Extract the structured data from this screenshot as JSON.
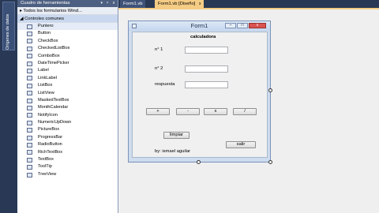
{
  "side_tabs": [
    {
      "label": "Orígenes de datos"
    },
    {
      "label": "Cuadro de herramientas"
    }
  ],
  "toolbox": {
    "title": "Cuadro de herramientas",
    "header_buttons": [
      "▾",
      "ᵖ",
      "x"
    ],
    "group_all": "▸ Todos los formularios Wind...",
    "group_common": "◢ Controles comunes",
    "items": [
      {
        "label": "Puntero",
        "icon": "pointer-icon"
      },
      {
        "label": "Button",
        "icon": "button-icon"
      },
      {
        "label": "CheckBox",
        "icon": "checkbox-icon"
      },
      {
        "label": "CheckedListBox",
        "icon": "checkedlistbox-icon"
      },
      {
        "label": "ComboBox",
        "icon": "combobox-icon"
      },
      {
        "label": "DateTimePicker",
        "icon": "datetimepicker-icon"
      },
      {
        "label": "Label",
        "icon": "label-icon"
      },
      {
        "label": "LinkLabel",
        "icon": "linklabel-icon"
      },
      {
        "label": "ListBox",
        "icon": "listbox-icon"
      },
      {
        "label": "ListView",
        "icon": "listview-icon"
      },
      {
        "label": "MaskedTextBox",
        "icon": "maskedtextbox-icon"
      },
      {
        "label": "MonthCalendar",
        "icon": "monthcalendar-icon"
      },
      {
        "label": "NotifyIcon",
        "icon": "notifyicon-icon"
      },
      {
        "label": "NumericUpDown",
        "icon": "numericupdown-icon"
      },
      {
        "label": "PictureBox",
        "icon": "picturebox-icon"
      },
      {
        "label": "ProgressBar",
        "icon": "progressbar-icon"
      },
      {
        "label": "RadioButton",
        "icon": "radiobutton-icon"
      },
      {
        "label": "RichTextBox",
        "icon": "richtextbox-icon"
      },
      {
        "label": "TextBox",
        "icon": "textbox-icon"
      },
      {
        "label": "ToolTip",
        "icon": "tooltip-icon"
      },
      {
        "label": "TreeView",
        "icon": "treeview-icon"
      }
    ]
  },
  "tabs": [
    {
      "label": "Form1.vb",
      "close": ""
    },
    {
      "label": "Form1.vb [Diseño]",
      "close": "x"
    }
  ],
  "form": {
    "title": "Form1",
    "heading": "calculadora",
    "label_n1": "n° 1",
    "label_n2": "n° 2",
    "label_respuesta": "respuesta",
    "value_n1": "",
    "value_n2": "",
    "value_respuesta": "",
    "btn_add": "+",
    "btn_sub": "-",
    "btn_mul": "x",
    "btn_div": "/",
    "btn_limpiar": "limpiar",
    "btn_salir": "salir",
    "author": "by: ismael aguilar",
    "min_glyph": "–",
    "max_glyph": "□",
    "close_glyph": "x"
  },
  "colors": {
    "ide_dark": "#293955",
    "active_tab": "#f5cc84",
    "form_frame": "#cfdcee"
  }
}
